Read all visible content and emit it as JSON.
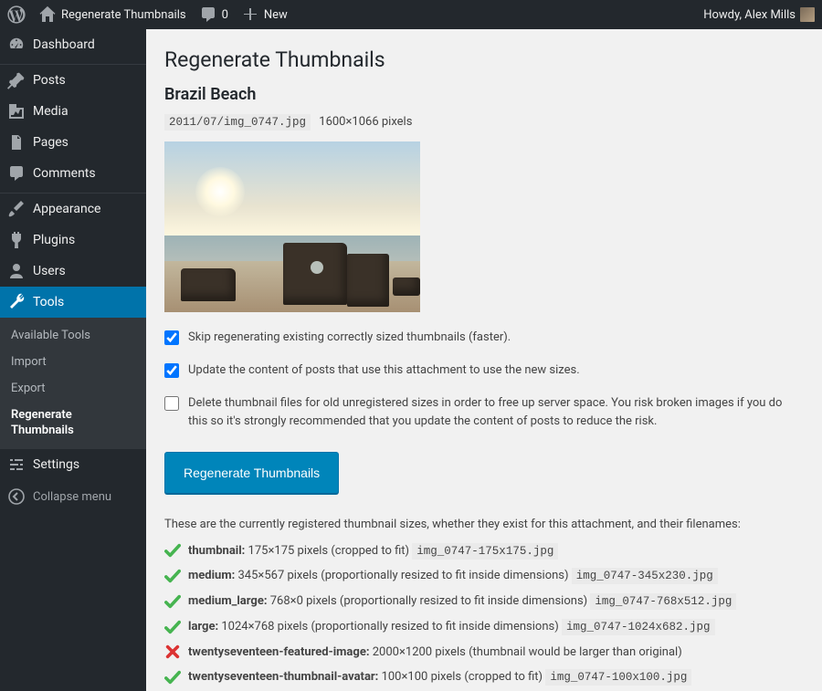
{
  "adminbar": {
    "site_name": "Regenerate Thumbnails",
    "comments_count": "0",
    "new_label": "New",
    "howdy": "Howdy, Alex Mills"
  },
  "sidebar": {
    "dashboard": "Dashboard",
    "posts": "Posts",
    "media": "Media",
    "pages": "Pages",
    "comments": "Comments",
    "appearance": "Appearance",
    "plugins": "Plugins",
    "users": "Users",
    "tools": "Tools",
    "settings": "Settings",
    "collapse": "Collapse menu",
    "tools_sub": {
      "available": "Available Tools",
      "import": "Import",
      "export": "Export",
      "regenerate": "Regenerate Thumbnails"
    }
  },
  "page": {
    "title": "Regenerate Thumbnails",
    "attachment_title": "Brazil Beach",
    "file_path": "2011/07/img_0747.jpg",
    "dimensions": "1600×1066 pixels",
    "check_skip": "Skip regenerating existing correctly sized thumbnails (faster).",
    "check_update": "Update the content of posts that use this attachment to use the new sizes.",
    "check_delete": "Delete thumbnail files for old unregistered sizes in order to free up server space. You risk broken images if you do this so it's strongly recommended that you update the content of posts to reduce the risk.",
    "button": "Regenerate Thumbnails",
    "sizes_intro": "These are the currently registered thumbnail sizes, whether they exist for this attachment, and their filenames:",
    "sizes": [
      {
        "ok": true,
        "name": "thumbnail",
        "desc": "175×175 pixels (cropped to fit)",
        "file": "img_0747-175x175.jpg"
      },
      {
        "ok": true,
        "name": "medium",
        "desc": "345×567 pixels (proportionally resized to fit inside dimensions)",
        "file": "img_0747-345x230.jpg"
      },
      {
        "ok": true,
        "name": "medium_large",
        "desc": "768×0 pixels (proportionally resized to fit inside dimensions)",
        "file": "img_0747-768x512.jpg"
      },
      {
        "ok": true,
        "name": "large",
        "desc": "1024×768 pixels (proportionally resized to fit inside dimensions)",
        "file": "img_0747-1024x682.jpg"
      },
      {
        "ok": false,
        "name": "twentyseventeen-featured-image",
        "desc": "2000×1200 pixels (thumbnail would be larger than original)",
        "file": ""
      },
      {
        "ok": true,
        "name": "twentyseventeen-thumbnail-avatar",
        "desc": "100×100 pixels (cropped to fit)",
        "file": "img_0747-100x100.jpg"
      }
    ]
  }
}
